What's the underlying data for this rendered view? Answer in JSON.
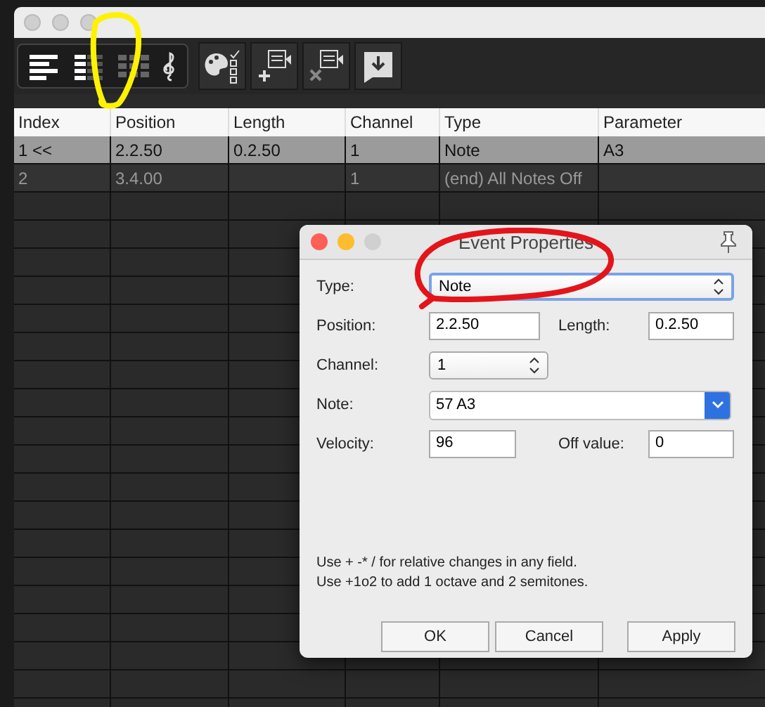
{
  "table": {
    "columns": [
      "Index",
      "Position",
      "Length",
      "Channel",
      "Type",
      "Parameter"
    ],
    "rows": [
      {
        "selected": true,
        "cells": [
          "1 <<",
          "2.2.50",
          "0.2.50",
          "1",
          "Note",
          "A3"
        ]
      },
      {
        "selected": false,
        "cells": [
          "2",
          "3.4.00",
          "",
          "1",
          "(end) All Notes Off",
          ""
        ]
      }
    ]
  },
  "dialog": {
    "title": "Event Properties",
    "type": {
      "label": "Type:",
      "value": "Note"
    },
    "position": {
      "label": "Position:",
      "value": "2.2.50"
    },
    "length": {
      "label": "Length:",
      "value": "0.2.50"
    },
    "channel": {
      "label": "Channel:",
      "value": "1"
    },
    "note": {
      "label": "Note:",
      "value": "57 A3"
    },
    "velocity": {
      "label": "Velocity:",
      "value": "96"
    },
    "off_value": {
      "label": "Off value:",
      "value": "0"
    },
    "hints": [
      "Use + -* / for relative changes in any field.",
      "Use +1o2  to add 1 octave and 2 semitones."
    ],
    "buttons": [
      "OK",
      "Cancel",
      "Apply"
    ]
  }
}
